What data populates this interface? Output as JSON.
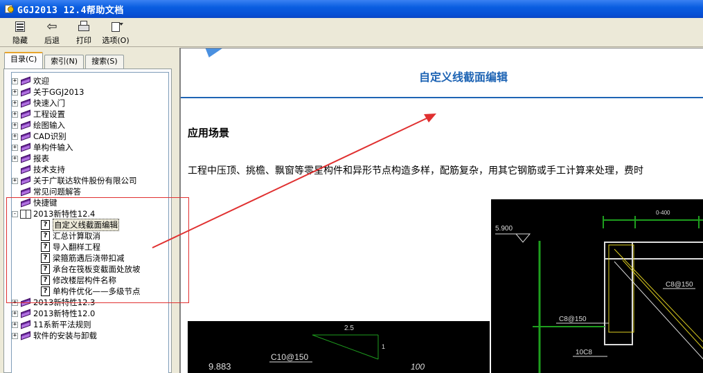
{
  "window": {
    "title": "GGJ2013 12.4帮助文档"
  },
  "toolbar": {
    "buttons": [
      {
        "label": "隐藏",
        "icon": "hide-pane-icon"
      },
      {
        "label": "后退",
        "icon": "back-arrow-icon"
      },
      {
        "label": "打印",
        "icon": "printer-icon"
      },
      {
        "label": "选项(O)",
        "icon": "options-icon"
      }
    ]
  },
  "tabs": [
    {
      "label": "目录(C)",
      "active": true
    },
    {
      "label": "索引(N)",
      "active": false
    },
    {
      "label": "搜索(S)",
      "active": false
    }
  ],
  "tree": [
    {
      "label": "欢迎",
      "type": "book",
      "exp": "+"
    },
    {
      "label": "关于GGJ2013",
      "type": "book",
      "exp": "+"
    },
    {
      "label": "快速入门",
      "type": "book",
      "exp": "+"
    },
    {
      "label": "工程设置",
      "type": "book",
      "exp": "+"
    },
    {
      "label": "绘图输入",
      "type": "book",
      "exp": "+"
    },
    {
      "label": "CAD识别",
      "type": "book",
      "exp": "+"
    },
    {
      "label": "单构件输入",
      "type": "book",
      "exp": "+"
    },
    {
      "label": "报表",
      "type": "book",
      "exp": "+"
    },
    {
      "label": "技术支持",
      "type": "book",
      "exp": ""
    },
    {
      "label": "关于广联达软件股份有限公司",
      "type": "book",
      "exp": "+"
    },
    {
      "label": "常见问题解答",
      "type": "book",
      "exp": ""
    },
    {
      "label": "快捷键",
      "type": "book",
      "exp": ""
    },
    {
      "label": "2013新特性12.4",
      "type": "openbook",
      "exp": "-"
    },
    {
      "label": "自定义线截面编辑",
      "type": "page",
      "exp": "",
      "selected": true
    },
    {
      "label": "汇总计算取消",
      "type": "page",
      "exp": ""
    },
    {
      "label": "导入翻样工程",
      "type": "page",
      "exp": ""
    },
    {
      "label": "梁箍筋遇后浇带扣减",
      "type": "page",
      "exp": ""
    },
    {
      "label": "承台在筏板变截面处放坡",
      "type": "page",
      "exp": ""
    },
    {
      "label": "修改楼层构件名称",
      "type": "page",
      "exp": ""
    },
    {
      "label": "单构件优化——多级节点",
      "type": "page",
      "exp": ""
    },
    {
      "label": "2013新特性12.3",
      "type": "book",
      "exp": "+"
    },
    {
      "label": "2013新特性12.0",
      "type": "book",
      "exp": "+"
    },
    {
      "label": "11系新平法规则",
      "type": "book",
      "exp": "+"
    },
    {
      "label": "软件的安装与卸载",
      "type": "book",
      "exp": "+"
    }
  ],
  "content": {
    "heading": "自定义线截面编辑",
    "section_title": "应用场景",
    "body": "工程中压顶、挑檐、飘窗等零星构件和异形节点构造多样，配筋复杂，用其它钢筋或手工计算来处理，费时",
    "cad1": {
      "t1": "2.5",
      "t2": "1",
      "t3": "C10@150",
      "t4": "9.883",
      "t5": "100"
    },
    "cad2": {
      "t1": "5.900",
      "t2": "0-400",
      "t3": "C8@150",
      "t4": "C8@150",
      "t5": "10C8"
    }
  },
  "colors": {
    "accent": "#1e64b4",
    "annotation": "#e03030"
  }
}
